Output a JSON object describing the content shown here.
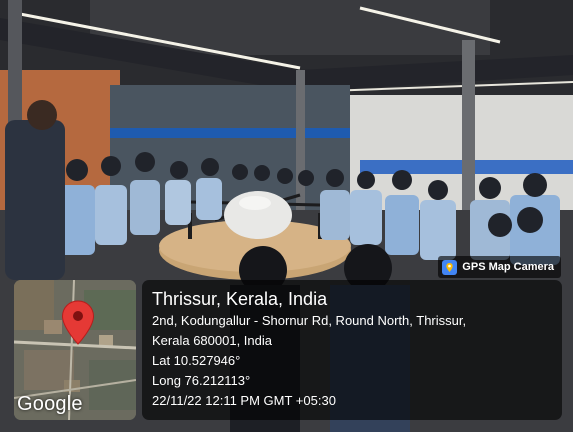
{
  "badge": {
    "label": "GPS Map Camera",
    "icon": "map-camera-icon"
  },
  "map": {
    "logo": "Google",
    "icon": "location-pin-icon",
    "pin_color": "#e53935"
  },
  "location": {
    "title": "Thrissur, Kerala, India",
    "address_line1": "2nd, Kodungallur - Shornur Rd, Round North, Thrissur,",
    "address_line2": "Kerala 680001, India",
    "latitude": "Lat 10.527946°",
    "longitude": "Long 76.212113°",
    "datetime": "22/11/22 12:11 PM GMT +05:30"
  }
}
